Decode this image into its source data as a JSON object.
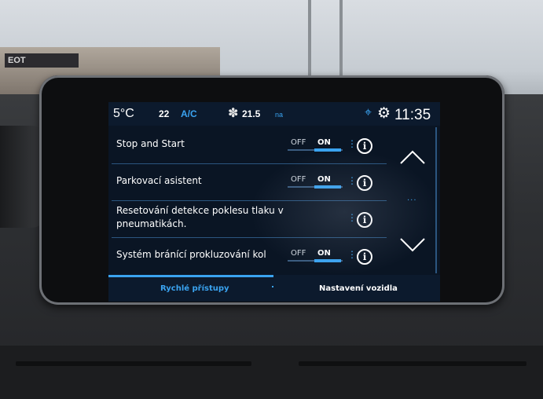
{
  "statusbar": {
    "outside_temp": "5°C",
    "ac_temp": "22",
    "ac_label": "A/C",
    "fan_icon": "fan-icon",
    "cabin_temp": "21.5",
    "cabin_unit": "na",
    "time": "11:35"
  },
  "settings": {
    "items": [
      {
        "label": "Stop and Start",
        "off": "OFF",
        "on": "ON",
        "state": "on"
      },
      {
        "label": "Parkovací asistent",
        "off": "OFF",
        "on": "ON",
        "state": "on"
      },
      {
        "label_line1": "Resetování detekce poklesu tlaku v",
        "label_line2": "pneumatikách."
      },
      {
        "label": "Systém bránící prokluzování kol",
        "off": "OFF",
        "on": "ON",
        "state": "on"
      }
    ],
    "info_glyph": "i"
  },
  "tabs": {
    "quick_access": "Rychlé přístupy",
    "vehicle_settings": "Nastavení vozidla"
  },
  "background": {
    "sign_text": "EOT"
  },
  "colors": {
    "accent": "#3aa3f0",
    "screen_bg": "#0a1524"
  }
}
